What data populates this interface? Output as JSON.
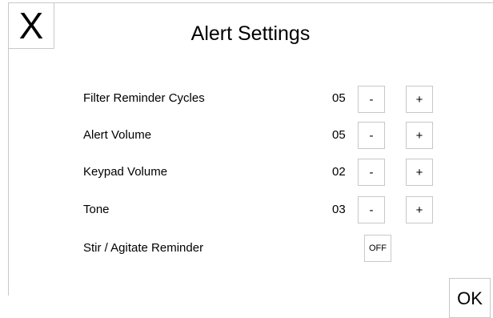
{
  "header": {
    "close_label": "X",
    "title": "Alert Settings"
  },
  "settings": [
    {
      "label": "Filter Reminder Cycles",
      "value": "05",
      "minus": "-",
      "plus": "+"
    },
    {
      "label": "Alert Volume",
      "value": "05",
      "minus": "-",
      "plus": "+"
    },
    {
      "label": "Keypad Volume",
      "value": "02",
      "minus": "-",
      "plus": "+"
    },
    {
      "label": "Tone",
      "value": "03",
      "minus": "-",
      "plus": "+"
    }
  ],
  "stir_reminder": {
    "label": "Stir / Agitate Reminder",
    "state": "OFF"
  },
  "footer": {
    "ok_label": "OK"
  }
}
